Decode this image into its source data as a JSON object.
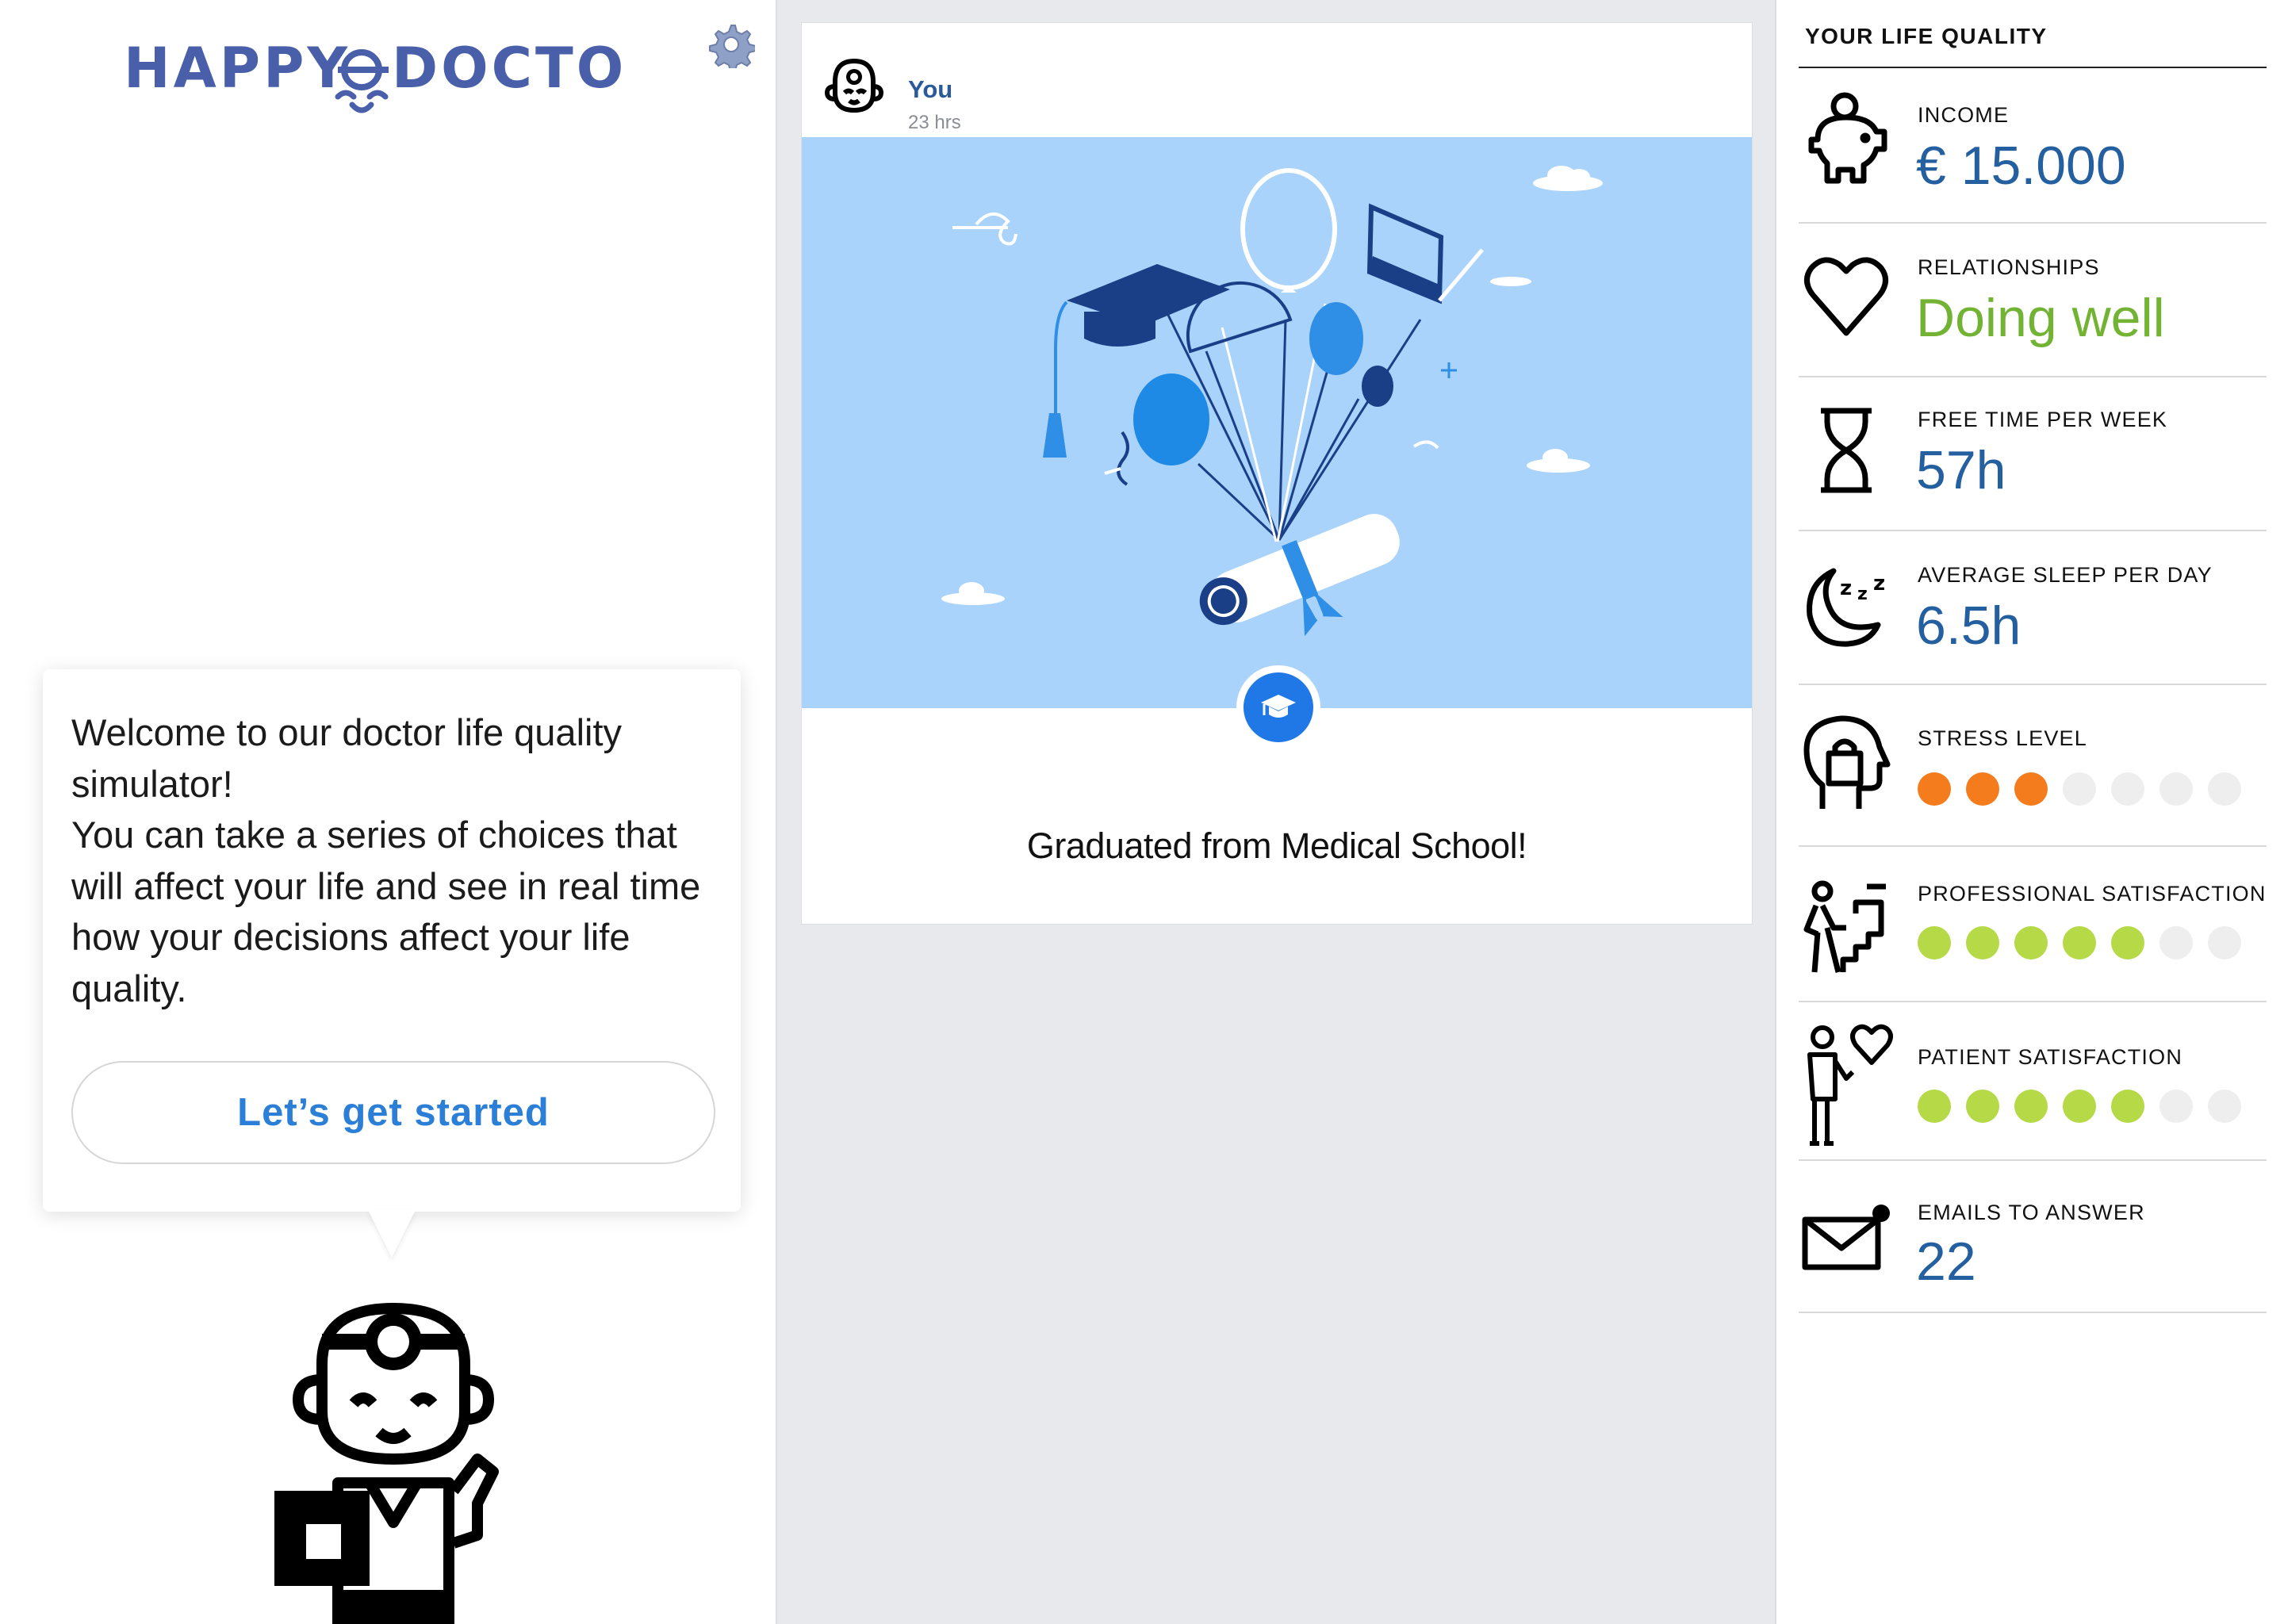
{
  "app": {
    "logo_text_left": "HAPPY",
    "logo_text_right": "DOCTOR",
    "accent_color": "#4a5fa9",
    "settings_icon": "gear-icon"
  },
  "intro": {
    "message": "Welcome to our doctor life quality simulator!\nYou can take a series of choices that will affect your life and see in real time how your decisions affect your life quality.",
    "cta_label": "Let’s get started"
  },
  "feed": {
    "posts": [
      {
        "author": "You",
        "time": "23 hrs",
        "title": "Graduated from Medical School!",
        "badge_icon": "graduation-cap-icon"
      }
    ]
  },
  "stats": {
    "header": "YOUR LIFE QUALITY",
    "income": {
      "label": "INCOME",
      "value": "€ 15.000",
      "icon": "piggy-bank-icon"
    },
    "relationships": {
      "label": "RELATIONSHIPS",
      "value": "Doing well",
      "icon": "heart-icon",
      "color": "#72b334"
    },
    "free_time": {
      "label": "FREE TIME PER WEEK",
      "value": "57h",
      "icon": "hourglass-icon"
    },
    "sleep": {
      "label": "AVERAGE SLEEP PER DAY",
      "value": "6.5h",
      "icon": "moon-sleep-icon"
    },
    "stress": {
      "label": "STRESS LEVEL",
      "level": 3,
      "max": 7,
      "color": "#f57c1c",
      "icon": "stressed-head-icon"
    },
    "professional": {
      "label": "PROFESSIONAL SATISFACTION",
      "level": 5,
      "max": 7,
      "color": "#b5d947",
      "icon": "climbing-stairs-icon"
    },
    "patient": {
      "label": "PATIENT SATISFACTION",
      "level": 5,
      "max": 7,
      "color": "#b5d947",
      "icon": "patient-heart-icon"
    },
    "emails": {
      "label": "EMAILS TO ANSWER",
      "value": "22",
      "icon": "envelope-notification-icon"
    }
  }
}
